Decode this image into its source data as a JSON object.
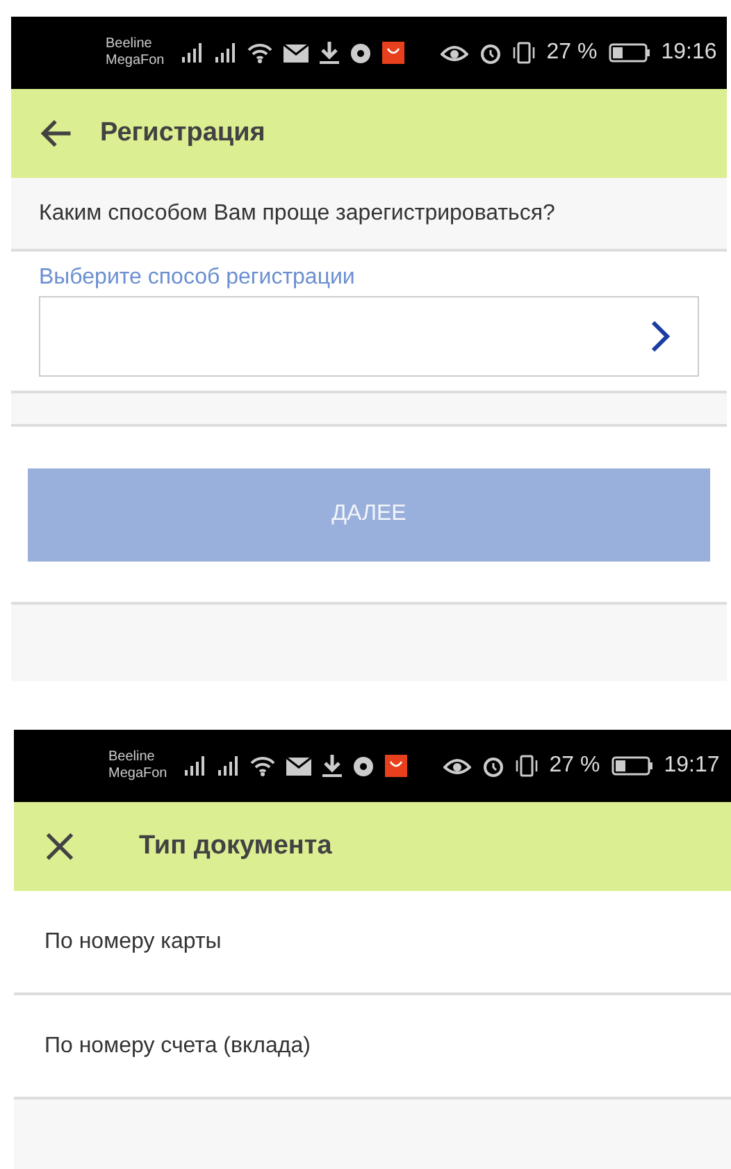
{
  "registration_screen": {
    "status_bar": {
      "carriers": [
        "Beeline",
        "MegaFon"
      ],
      "battery": "27 %",
      "time": "19:16"
    },
    "header": {
      "nav_button": {
        "kind": "back"
      },
      "title": "Регистрация"
    },
    "question": "Каким способом Вам проще зарегистрироваться?",
    "method_field": {
      "label": "Выберите способ регистрации"
    },
    "next_button": {
      "label": "ДАЛЕЕ",
      "disabled": true
    }
  },
  "document_type_screen": {
    "status_bar": {
      "carriers": [
        "Beeline",
        "MegaFon"
      ],
      "battery": "27 %",
      "time": "19:17"
    },
    "header": {
      "nav_button": {
        "kind": "close"
      },
      "title": "Тип документа"
    },
    "options": [
      {
        "label": "По номеру карты"
      },
      {
        "label": "По номеру счета (вклада)"
      }
    ]
  }
}
